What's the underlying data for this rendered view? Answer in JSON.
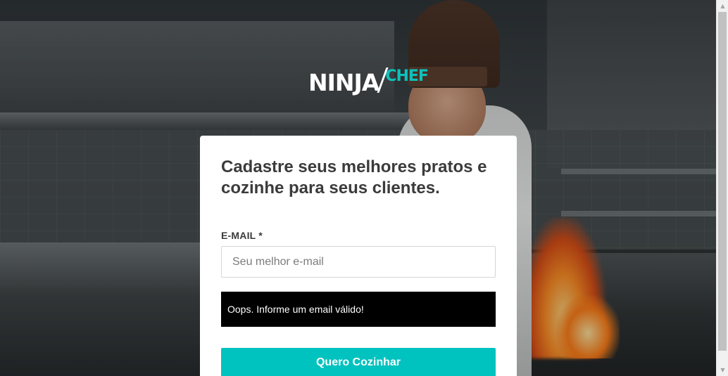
{
  "logo": {
    "primary": "NINJA",
    "secondary": "CHEF",
    "accent_color": "#0fc1bb"
  },
  "form": {
    "headline": "Cadastre seus melhores pratos e cozinhe para seus clientes.",
    "email_label": "E-MAIL *",
    "email_value": "",
    "email_placeholder": "Seu melhor e-mail",
    "error_message": "Oops. Informe um email válido!",
    "submit_label": "Quero Cozinhar",
    "button_color": "#00c2bf"
  },
  "scrollbar": {
    "up_icon": "triangle-up-icon",
    "down_icon": "triangle-down-icon"
  }
}
